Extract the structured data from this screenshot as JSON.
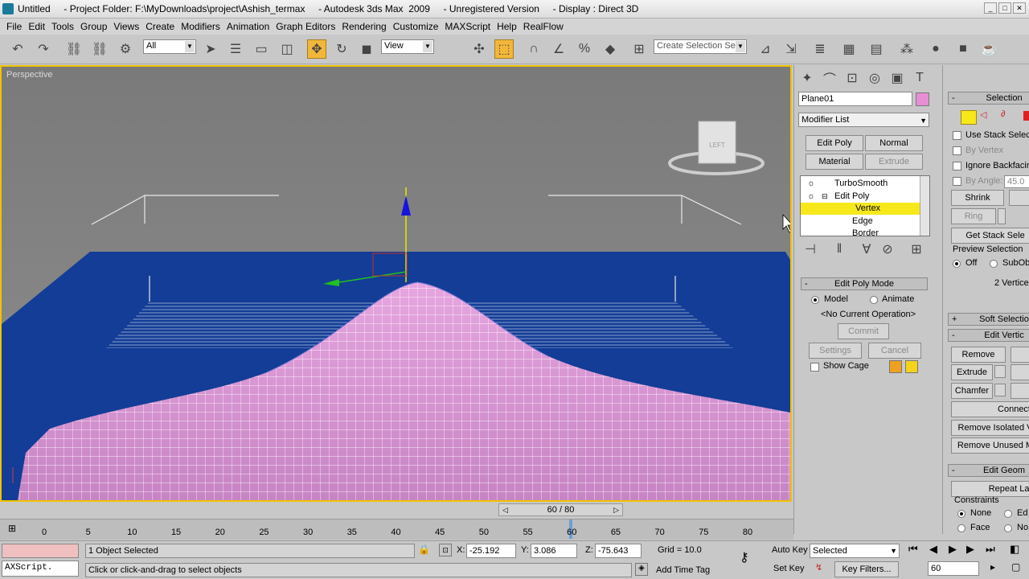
{
  "titlebar": {
    "text": "Untitled     - Project Folder: F:\\MyDownloads\\project\\Ashish_termax     - Autodesk 3ds Max  2009     - Unregistered Version     - Display : Direct 3D"
  },
  "menu": [
    "File",
    "Edit",
    "Tools",
    "Group",
    "Views",
    "Create",
    "Modifiers",
    "Animation",
    "Graph Editors",
    "Rendering",
    "Customize",
    "MAXScript",
    "Help",
    "RealFlow"
  ],
  "toolbar": {
    "selection_filter": "All",
    "reference_coord": "View",
    "named_selection_placeholder": "Create Selection Se"
  },
  "viewport": {
    "label": "Perspective",
    "cube_label": "LEFT"
  },
  "cmdpanel": {
    "object_name": "Plane01",
    "object_color": "#e88ed6",
    "modifier_list": "Modifier List",
    "btn_edit_poly": "Edit Poly",
    "btn_normal": "Normal",
    "btn_material": "Material",
    "btn_extrude": "Extrude",
    "stack": [
      {
        "label": "TurboSmooth",
        "selected": false
      },
      {
        "label": "Edit Poly",
        "selected": false
      },
      {
        "label": "Vertex",
        "selected": true
      },
      {
        "label": "Edge",
        "selected": false
      },
      {
        "label": "Border",
        "selected": false
      }
    ],
    "edit_poly_mode": {
      "title": "Edit Poly Mode",
      "model": "Model",
      "animate": "Animate",
      "current_op": "<No Current Operation>",
      "commit": "Commit",
      "settings": "Settings",
      "cancel": "Cancel",
      "show_cage": "Show Cage",
      "cage_color_1": "#f0a020",
      "cage_color_2": "#f4d31a"
    }
  },
  "cmdpanel2": {
    "selection_title": "Selection",
    "use_stack": "Use Stack Selec",
    "by_vertex": "By Vertex",
    "ignore_backfacing": "Ignore Backfacin",
    "by_angle": "By Angle:",
    "by_angle_value": "45.0",
    "shrink": "Shrink",
    "ring": "Ring",
    "get_stack": "Get Stack Sele",
    "preview_selection": "Preview Selection",
    "off": "Off",
    "subobj": "SubObj",
    "vertices_selected": "2 Vertice",
    "soft_selection": "Soft Selectio",
    "edit_vertices": "Edit Vertic",
    "remove": "Remove",
    "extrude": "Extrude",
    "chamfer": "Chamfer",
    "connect": "Connect",
    "remove_isolated": "Remove Isolated V",
    "remove_unused": "Remove Unused M",
    "edit_geometry": "Edit Geom",
    "repeat_last": "Repeat Las",
    "constraints": "Constraints",
    "none": "None",
    "face": "Face",
    "edge_short": "Ed",
    "normal_short": "No"
  },
  "timeline": {
    "frame": "60 / 80",
    "ticks": [
      "0",
      "5",
      "10",
      "15",
      "20",
      "25",
      "30",
      "35",
      "40",
      "45",
      "50",
      "55",
      "60",
      "65",
      "70",
      "75",
      "80"
    ]
  },
  "status": {
    "maxscript": "AXScript.",
    "objects_selected": "1 Object Selected",
    "prompt": "Click or click-and-drag to select objects",
    "x_label": "X:",
    "x": "-25.192",
    "y_label": "Y:",
    "y": "3.086",
    "z_label": "Z:",
    "z": "-75.643",
    "grid": "Grid = 10.0",
    "add_time_tag": "Add Time Tag",
    "auto_key": "Auto Key",
    "set_key": "Set Key",
    "selected_dropdown": "Selected",
    "key_filters": "Key Filters...",
    "current_frame": "60"
  }
}
